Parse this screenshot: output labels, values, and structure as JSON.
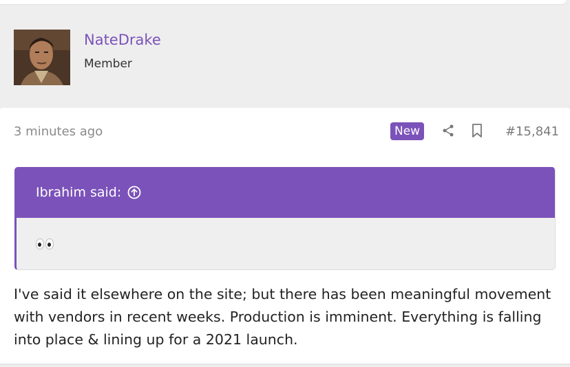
{
  "user": {
    "username": "NateDrake",
    "title": "Member",
    "avatar_icon": "user-avatar-photo"
  },
  "post": {
    "time": "3 minutes ago",
    "badge": "New",
    "share_icon": "share-icon",
    "bookmark_icon": "bookmark-icon",
    "number": "#15,841",
    "quote": {
      "author_label": "Ibrahim said:",
      "expand_icon": "arrow-up-circle-icon",
      "content_icon": "eyes-emoji"
    },
    "body": "I've said it elsewhere on the site; but there has been meaningful movement with vendors in recent weeks. Production is imminent. Everything is falling into place & lining up for a 2021 launch."
  },
  "colors": {
    "accent": "#7b52b9",
    "background": "#eeeeee",
    "card": "#ffffff"
  }
}
